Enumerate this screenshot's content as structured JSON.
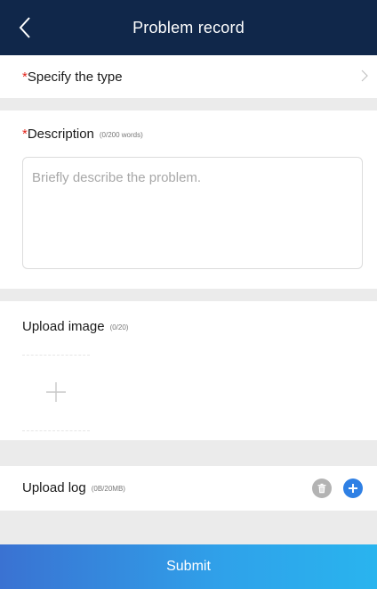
{
  "header": {
    "title": "Problem record",
    "back_icon": "chevron-left-icon"
  },
  "type_row": {
    "required_mark": "*",
    "label": "Specify the type",
    "chevron_icon": "chevron-right-icon"
  },
  "description": {
    "required_mark": "*",
    "label": "Description",
    "count": "(0/200 words)",
    "placeholder": "Briefly describe the problem.",
    "value": ""
  },
  "upload_image": {
    "label": "Upload image",
    "count": "(0/20)",
    "add_icon": "plus-icon"
  },
  "upload_log": {
    "label": "Upload log",
    "count": "(0B/20MB)",
    "delete_icon": "trash-icon",
    "add_icon": "plus-circle-icon"
  },
  "submit": {
    "label": "Submit"
  },
  "colors": {
    "header_bg": "#10274a",
    "required": "#e2231a",
    "accent_blue": "#2f80e4",
    "page_bg": "#ebebeb"
  }
}
